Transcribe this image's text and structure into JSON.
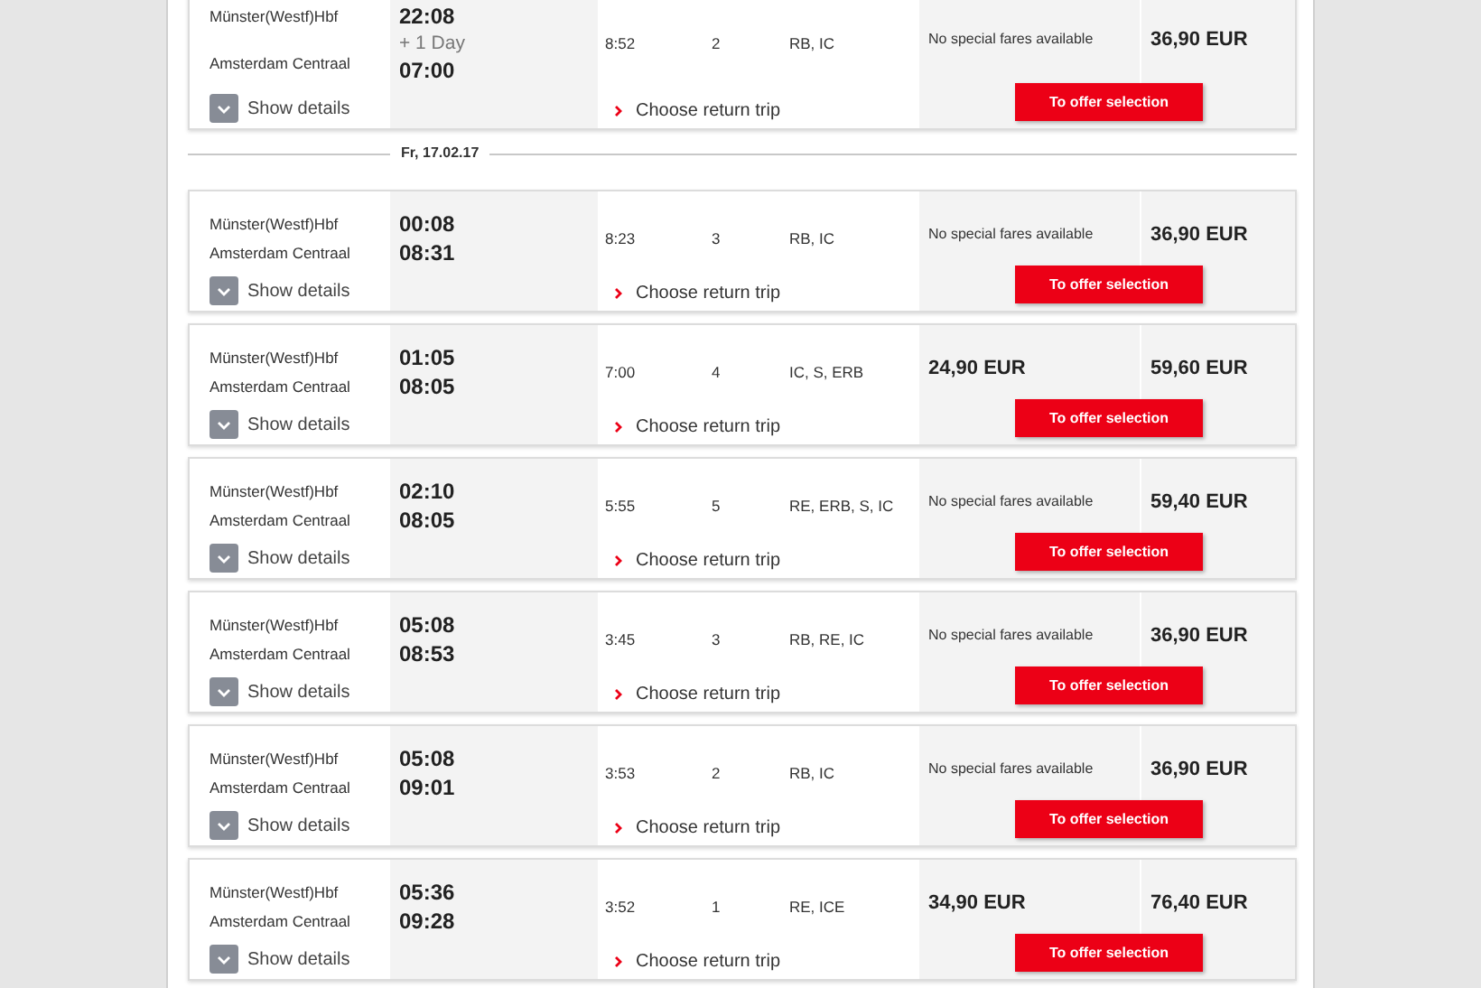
{
  "items": [
    {
      "kind": "connection",
      "from": "Münster(Westf)Hbf",
      "to": "Amsterdam Centraal",
      "departure": "22:08",
      "day_note": "+ 1 Day",
      "arrival": "07:00",
      "duration": "8:52",
      "changes": "2",
      "products": "RB, IC",
      "fare_special": {
        "kind": "note",
        "text": "No special fares available"
      },
      "fare_normal": "36,90 EUR",
      "details": "Show details",
      "return_trip": "Choose return trip",
      "offer_button": "To offer selection"
    },
    {
      "kind": "date",
      "text": "Fr, 17.02.17"
    },
    {
      "kind": "connection",
      "from": "Münster(Westf)Hbf",
      "to": "Amsterdam Centraal",
      "departure": "00:08",
      "arrival": "08:31",
      "duration": "8:23",
      "changes": "3",
      "products": "RB, IC",
      "fare_special": {
        "kind": "note",
        "text": "No special fares available"
      },
      "fare_normal": "36,90 EUR",
      "details": "Show details",
      "return_trip": "Choose return trip",
      "offer_button": "To offer selection"
    },
    {
      "kind": "connection",
      "from": "Münster(Westf)Hbf",
      "to": "Amsterdam Centraal",
      "departure": "01:05",
      "arrival": "08:05",
      "duration": "7:00",
      "changes": "4",
      "products": "IC, S, ERB",
      "fare_special": {
        "kind": "price",
        "text": "24,90 EUR"
      },
      "fare_normal": "59,60 EUR",
      "details": "Show details",
      "return_trip": "Choose return trip",
      "offer_button": "To offer selection"
    },
    {
      "kind": "connection",
      "from": "Münster(Westf)Hbf",
      "to": "Amsterdam Centraal",
      "departure": "02:10",
      "arrival": "08:05",
      "duration": "5:55",
      "changes": "5",
      "products": "RE, ERB, S, IC",
      "fare_special": {
        "kind": "note",
        "text": "No special fares available"
      },
      "fare_normal": "59,40 EUR",
      "details": "Show details",
      "return_trip": "Choose return trip",
      "offer_button": "To offer selection"
    },
    {
      "kind": "connection",
      "from": "Münster(Westf)Hbf",
      "to": "Amsterdam Centraal",
      "departure": "05:08",
      "arrival": "08:53",
      "duration": "3:45",
      "changes": "3",
      "products": "RB, RE, IC",
      "fare_special": {
        "kind": "note",
        "text": "No special fares available"
      },
      "fare_normal": "36,90 EUR",
      "details": "Show details",
      "return_trip": "Choose return trip",
      "offer_button": "To offer selection"
    },
    {
      "kind": "connection",
      "from": "Münster(Westf)Hbf",
      "to": "Amsterdam Centraal",
      "departure": "05:08",
      "arrival": "09:01",
      "duration": "3:53",
      "changes": "2",
      "products": "RB, IC",
      "fare_special": {
        "kind": "note",
        "text": "No special fares available"
      },
      "fare_normal": "36,90 EUR",
      "details": "Show details",
      "return_trip": "Choose return trip",
      "offer_button": "To offer selection"
    },
    {
      "kind": "connection",
      "from": "Münster(Westf)Hbf",
      "to": "Amsterdam Centraal",
      "departure": "05:36",
      "arrival": "09:28",
      "duration": "3:52",
      "changes": "1",
      "products": "RE, ICE",
      "fare_special": {
        "kind": "price",
        "text": "34,90 EUR"
      },
      "fare_normal": "76,40 EUR",
      "details": "Show details",
      "return_trip": "Choose return trip",
      "offer_button": "To offer selection"
    }
  ]
}
